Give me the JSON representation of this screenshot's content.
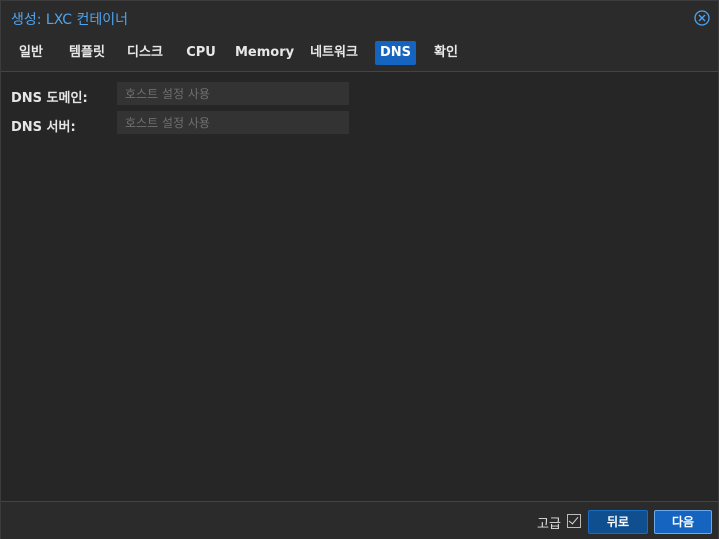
{
  "window": {
    "title": "생성: LXC 컨테이너",
    "close_icon": "close-circle-icon",
    "accent_color": "#4ea4f0"
  },
  "tabs": [
    {
      "label": "일반"
    },
    {
      "label": "템플릿"
    },
    {
      "label": "디스크"
    },
    {
      "label": "CPU"
    },
    {
      "label": "Memory"
    },
    {
      "label": "네트워크"
    },
    {
      "label": "DNS",
      "active": true
    },
    {
      "label": "확인"
    }
  ],
  "form": {
    "dns_domain": {
      "label": "DNS 도메인:",
      "value": "",
      "placeholder": "호스트 설정 사용"
    },
    "dns_server": {
      "label": "DNS 서버:",
      "value": "",
      "placeholder": "호스트 설정 사용"
    }
  },
  "footer": {
    "advanced_label": "고급",
    "advanced_checked": true,
    "back_label": "뒤로",
    "next_label": "다음"
  }
}
